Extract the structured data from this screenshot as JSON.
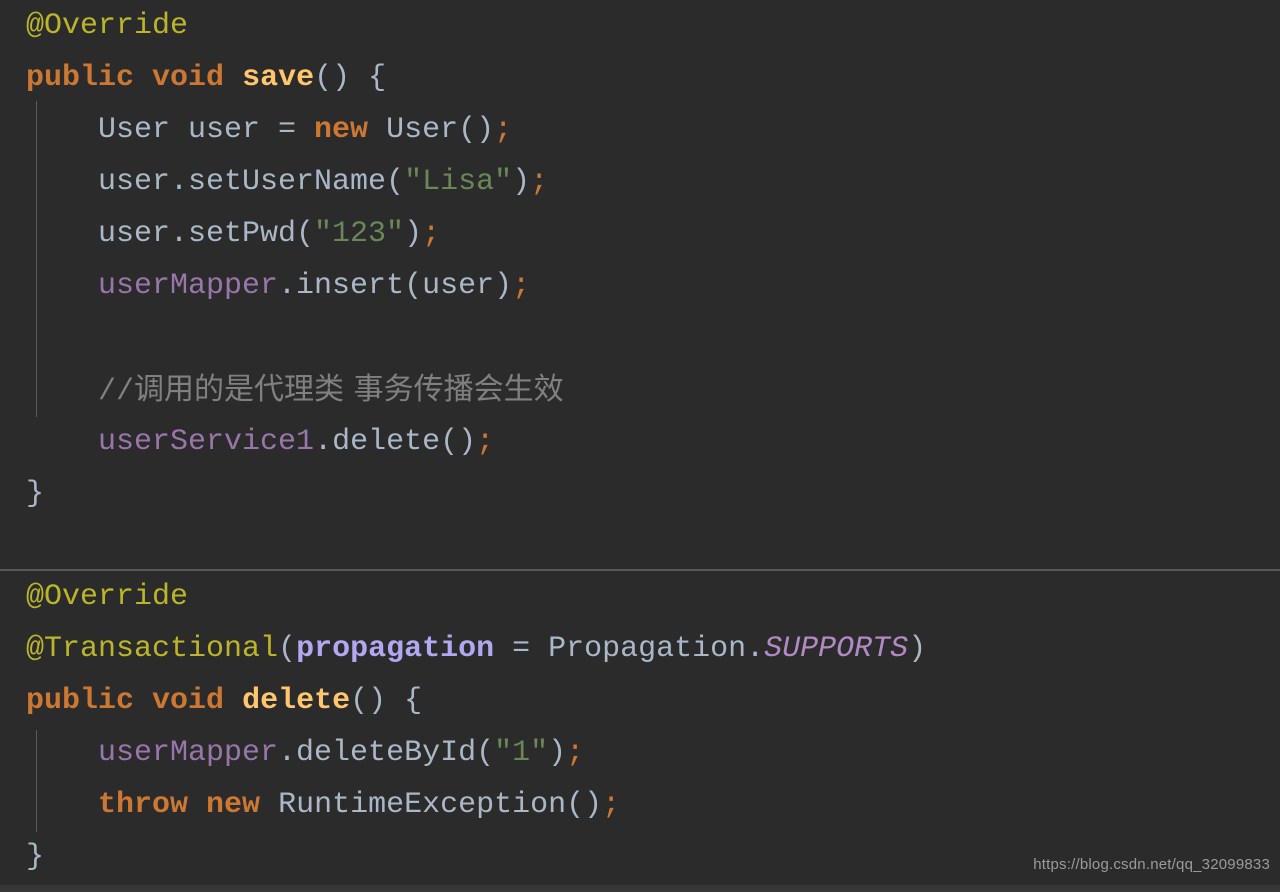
{
  "editor": {
    "theme_name": "darcula",
    "background_color": "#2b2b2b",
    "divider_color": "#595959",
    "indent_guide_color": "#585a5c",
    "palette": {
      "annotation": "#bbb529",
      "keyword": "#cc7832",
      "method_declaration": "#ffc66d",
      "identifier": "#a9b7c6",
      "string": "#6a8759",
      "field": "#9876aa",
      "named_parameter": "#b0a8f0",
      "static_final": "#b389c5",
      "comment": "#808080"
    }
  },
  "blocks": [
    {
      "id": "save-method-block",
      "lines": [
        {
          "id": "line-override-1",
          "tokens": [
            {
              "kind": "annotation",
              "text": "@Override"
            }
          ]
        },
        {
          "id": "line-public-void-save",
          "tokens": [
            {
              "kind": "keyword",
              "text": "public"
            },
            {
              "kind": "ident",
              "text": " "
            },
            {
              "kind": "keyword",
              "text": "void"
            },
            {
              "kind": "ident",
              "text": " "
            },
            {
              "kind": "methoddecl",
              "text": "save"
            },
            {
              "kind": "punct",
              "text": "() {"
            }
          ]
        },
        {
          "id": "line-new-user",
          "tokens": [
            {
              "kind": "ident",
              "text": "    User user = "
            },
            {
              "kind": "keyword",
              "text": "new"
            },
            {
              "kind": "ident",
              "text": " User()"
            },
            {
              "kind": "semicolon",
              "text": ";"
            }
          ]
        },
        {
          "id": "line-set-username",
          "tokens": [
            {
              "kind": "ident",
              "text": "    user.setUserName("
            },
            {
              "kind": "string",
              "text": "\"Lisa\""
            },
            {
              "kind": "ident",
              "text": ")"
            },
            {
              "kind": "semicolon",
              "text": ";"
            }
          ]
        },
        {
          "id": "line-set-pwd",
          "tokens": [
            {
              "kind": "ident",
              "text": "    user.setPwd("
            },
            {
              "kind": "string",
              "text": "\"123\""
            },
            {
              "kind": "ident",
              "text": ")"
            },
            {
              "kind": "semicolon",
              "text": ";"
            }
          ]
        },
        {
          "id": "line-mapper-insert",
          "tokens": [
            {
              "kind": "ident",
              "text": "    "
            },
            {
              "kind": "field",
              "text": "userMapper"
            },
            {
              "kind": "ident",
              "text": ".insert(user)"
            },
            {
              "kind": "semicolon",
              "text": ";"
            }
          ]
        },
        {
          "id": "line-blank-1",
          "tokens": [
            {
              "kind": "ident",
              "text": " "
            }
          ]
        },
        {
          "id": "line-comment-cjk",
          "tokens": [
            {
              "kind": "comment",
              "text": "    //"
            },
            {
              "kind": "comment-cjk",
              "text": "调用的是代理类 事务传播会生效"
            }
          ]
        },
        {
          "id": "line-service-delete",
          "tokens": [
            {
              "kind": "ident",
              "text": "    "
            },
            {
              "kind": "field",
              "text": "userService1"
            },
            {
              "kind": "ident",
              "text": ".delete()"
            },
            {
              "kind": "semicolon",
              "text": ";"
            }
          ]
        },
        {
          "id": "line-close-brace-1",
          "tokens": [
            {
              "kind": "punct",
              "text": "}"
            }
          ]
        }
      ]
    },
    {
      "id": "delete-method-block",
      "lines": [
        {
          "id": "line-override-2",
          "tokens": [
            {
              "kind": "annotation",
              "text": "@Override"
            }
          ]
        },
        {
          "id": "line-transactional",
          "tokens": [
            {
              "kind": "annotation",
              "text": "@Transactional"
            },
            {
              "kind": "punct",
              "text": "("
            },
            {
              "kind": "param",
              "text": "propagation"
            },
            {
              "kind": "ident",
              "text": " = Propagation."
            },
            {
              "kind": "staticfinal",
              "text": "SUPPORTS"
            },
            {
              "kind": "punct",
              "text": ")"
            }
          ]
        },
        {
          "id": "line-public-void-delete",
          "tokens": [
            {
              "kind": "keyword",
              "text": "public"
            },
            {
              "kind": "ident",
              "text": " "
            },
            {
              "kind": "keyword",
              "text": "void"
            },
            {
              "kind": "ident",
              "text": " "
            },
            {
              "kind": "methoddecl",
              "text": "delete"
            },
            {
              "kind": "punct",
              "text": "() {"
            }
          ]
        },
        {
          "id": "line-mapper-deletebyid",
          "tokens": [
            {
              "kind": "ident",
              "text": "    "
            },
            {
              "kind": "field",
              "text": "userMapper"
            },
            {
              "kind": "ident",
              "text": ".deleteById("
            },
            {
              "kind": "string",
              "text": "\"1\""
            },
            {
              "kind": "ident",
              "text": ")"
            },
            {
              "kind": "semicolon",
              "text": ";"
            }
          ]
        },
        {
          "id": "line-throw-runtime",
          "tokens": [
            {
              "kind": "ident",
              "text": "    "
            },
            {
              "kind": "keyword",
              "text": "throw"
            },
            {
              "kind": "ident",
              "text": " "
            },
            {
              "kind": "keyword",
              "text": "new"
            },
            {
              "kind": "ident",
              "text": " RuntimeException()"
            },
            {
              "kind": "semicolon",
              "text": ";"
            }
          ]
        },
        {
          "id": "line-close-brace-2",
          "tokens": [
            {
              "kind": "punct",
              "text": "}"
            }
          ]
        }
      ]
    }
  ],
  "watermark": {
    "text": "https://blog.csdn.net/qq_32099833"
  }
}
